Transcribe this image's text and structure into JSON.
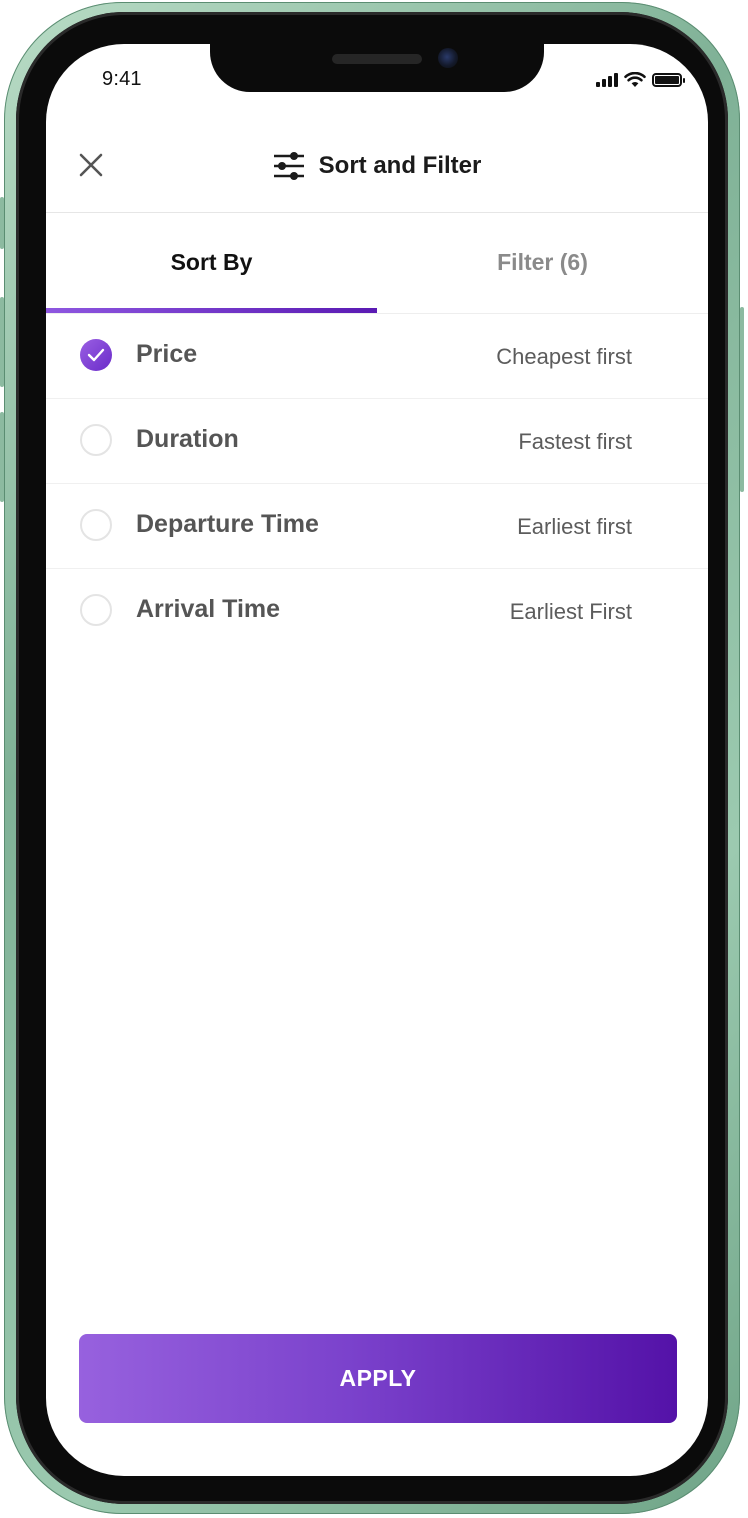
{
  "status_bar": {
    "time": "9:41"
  },
  "header": {
    "title": "Sort and Filter",
    "close_icon": "close-icon",
    "title_icon": "sliders-icon"
  },
  "tabs": [
    {
      "label": "Sort By",
      "active": true
    },
    {
      "label": "Filter (6)",
      "active": false
    }
  ],
  "sort_options": [
    {
      "label": "Price",
      "description": "Cheapest first",
      "selected": true
    },
    {
      "label": "Duration",
      "description": "Fastest first",
      "selected": false
    },
    {
      "label": "Departure Time",
      "description": "Earliest first",
      "selected": false
    },
    {
      "label": "Arrival Time",
      "description": "Earliest First",
      "selected": false
    }
  ],
  "apply_button": {
    "label": "APPLY"
  },
  "colors": {
    "accent_start": "#9761de",
    "accent_end": "#5412a8",
    "frame": "#8cbaa0"
  }
}
